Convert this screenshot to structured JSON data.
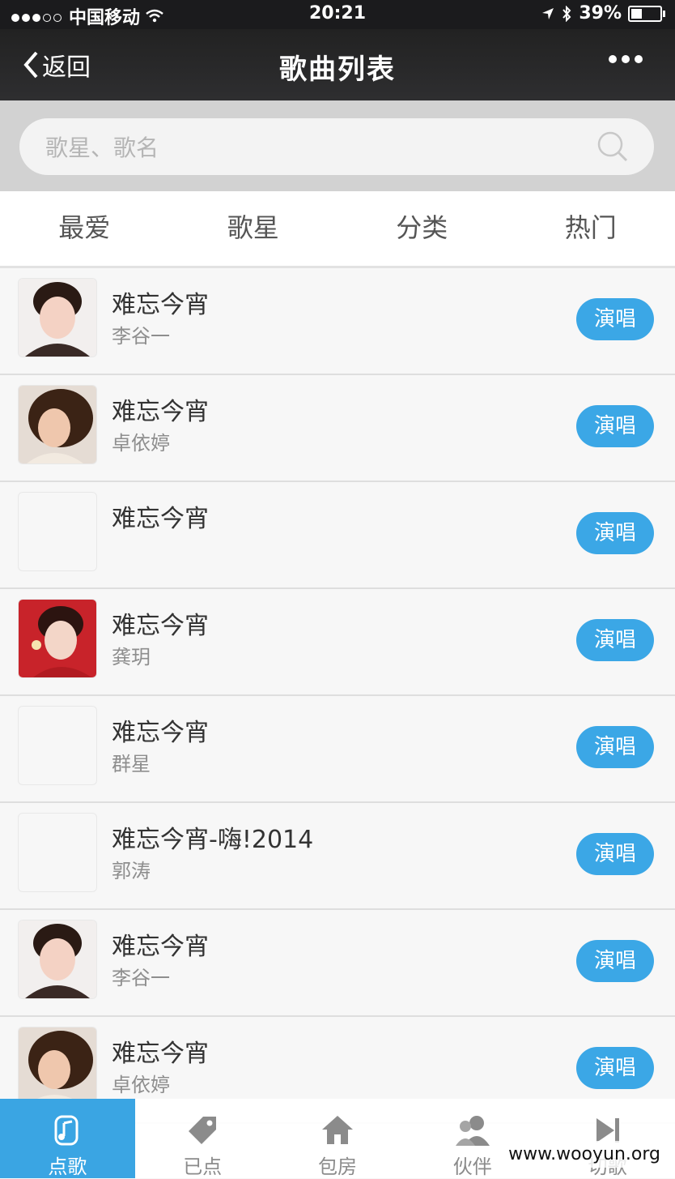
{
  "status": {
    "carrier": "中国移动",
    "time": "20:21",
    "battery": "39%"
  },
  "nav": {
    "back_label": "返回",
    "title": "歌曲列表"
  },
  "search": {
    "placeholder": "歌星、歌名"
  },
  "tabs": [
    {
      "label": "最爱"
    },
    {
      "label": "歌星"
    },
    {
      "label": "分类"
    },
    {
      "label": "热门"
    }
  ],
  "sing_label": "演唱",
  "songs": [
    {
      "title": "难忘今宵",
      "artist": "李谷一"
    },
    {
      "title": "难忘今宵",
      "artist": "卓依婷"
    },
    {
      "title": "难忘今宵",
      "artist": ""
    },
    {
      "title": "难忘今宵",
      "artist": "龚玥"
    },
    {
      "title": "难忘今宵",
      "artist": "群星"
    },
    {
      "title": "难忘今宵-嗨!2014",
      "artist": "郭涛"
    },
    {
      "title": "难忘今宵",
      "artist": "李谷一"
    },
    {
      "title": "难忘今宵",
      "artist": "卓依婷"
    }
  ],
  "tabbar": [
    {
      "label": "点歌",
      "icon": "music-note-icon",
      "active": true
    },
    {
      "label": "已点",
      "icon": "tag-icon"
    },
    {
      "label": "包房",
      "icon": "home-icon"
    },
    {
      "label": "伙伴",
      "icon": "people-icon"
    },
    {
      "label": "切歌",
      "icon": "skip-icon"
    }
  ],
  "watermark": "www.wooyun.org"
}
